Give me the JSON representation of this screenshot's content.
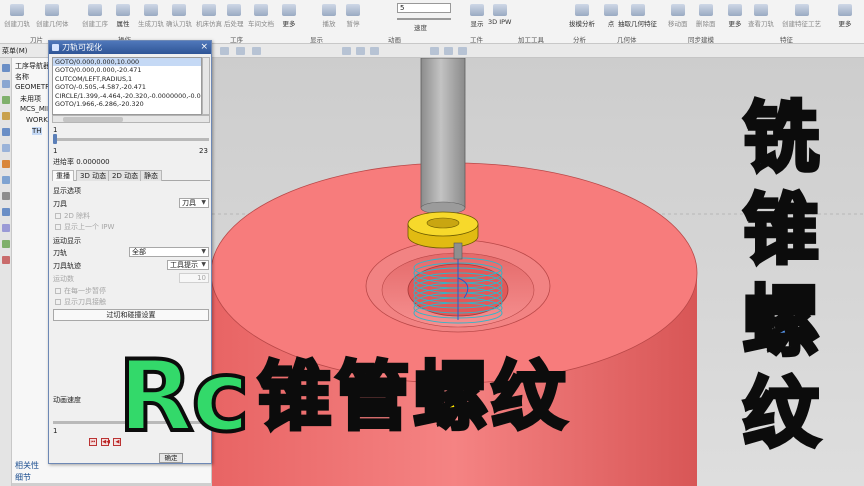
{
  "ribbon": {
    "buttons": [
      "创建刀轨",
      "创建几何体",
      "创建工序",
      "属性",
      "生成刀轨",
      "确认刀轨",
      "机床仿真",
      "后处理",
      "车间文档",
      "更多",
      "播放",
      "暂停",
      "速度",
      "显示",
      "3D IPW",
      "拔模分析",
      "点",
      "抽取几何特征",
      "移动面",
      "删除面",
      "替换面",
      "同步建模",
      "更多",
      "查看刀轨",
      "创建特征工艺",
      "更多"
    ],
    "groups": [
      "刀片",
      "操作",
      "工序",
      "显示",
      "动画",
      "工件",
      "加工工具",
      "分析",
      "几何体",
      "同步建模",
      "特征"
    ],
    "speed_value": "5",
    "speed_label": "速度"
  },
  "toolbar": {
    "menu_label": "菜单(M)"
  },
  "navigator": {
    "title": "工序导航器",
    "rows": [
      "名称",
      "GEOMETRY",
      "未用项",
      "MCS_MILL",
      "WORKPIECE",
      "TH"
    ],
    "related": "相关性",
    "detail": "细节"
  },
  "dialog": {
    "title": "刀轨可视化",
    "close_label": "×",
    "code_lines": [
      "GOTO/0.000,0.000,10.000",
      "GOTO/0.000,0.000,-20.471",
      "CUTCOM/LEFT,RADIUS,1",
      "GOTO/-0.505,-4.587,-20.471",
      "CIRCLE/1.399,-4.464,-20.320,-0.0000000,-0.0",
      "GOTO/1.966,-6.286,-20.320"
    ],
    "step_current": "1",
    "step_min": "1",
    "step_max": "23",
    "step_fraction": 0.0,
    "feedrate": "进给率 0.000000",
    "tabs": [
      "重播",
      "3D 动态",
      "2D 动态",
      "静态"
    ],
    "display_options_title": "显示选项",
    "tool_label": "刀具",
    "tool_value": "刀具",
    "check_2d_remove": "2D 除料",
    "check_prev_ipw": "显示上一个 IPW",
    "motion_display_title": "运动显示",
    "tool_path_label": "刀轨",
    "tool_path_value": "全部",
    "tool_trace_label": "刀具轨迹",
    "tool_trace_value": "工具提示",
    "motion_count_label": "运动数",
    "motion_count_value": "10",
    "check_every_step": "在每一步暂停",
    "check_tool_contact": "显示刀具接触",
    "collision_button": "过切和碰撞设置",
    "anim_speed_label": "动画速度",
    "anim_speed_value": "1",
    "player_buttons": [
      "⏮",
      "◀◀",
      "◀",
      "▶",
      "▶▶",
      "⏭",
      "■"
    ],
    "ok_label": "确定"
  },
  "overlay": {
    "title_rc": "Rc",
    "title_cn": "锥管螺纹",
    "side_chars": [
      "铣",
      "锥",
      "螺",
      "纹"
    ]
  },
  "colors": {
    "workpiece": "#f47a7a",
    "holder": "#a9a9a9",
    "nut": "#f5d21f",
    "helix": "#33b5c8",
    "title_green": "#33d96a",
    "title_yellow": "#ffe400",
    "side_blue": "#5a9bf5"
  }
}
